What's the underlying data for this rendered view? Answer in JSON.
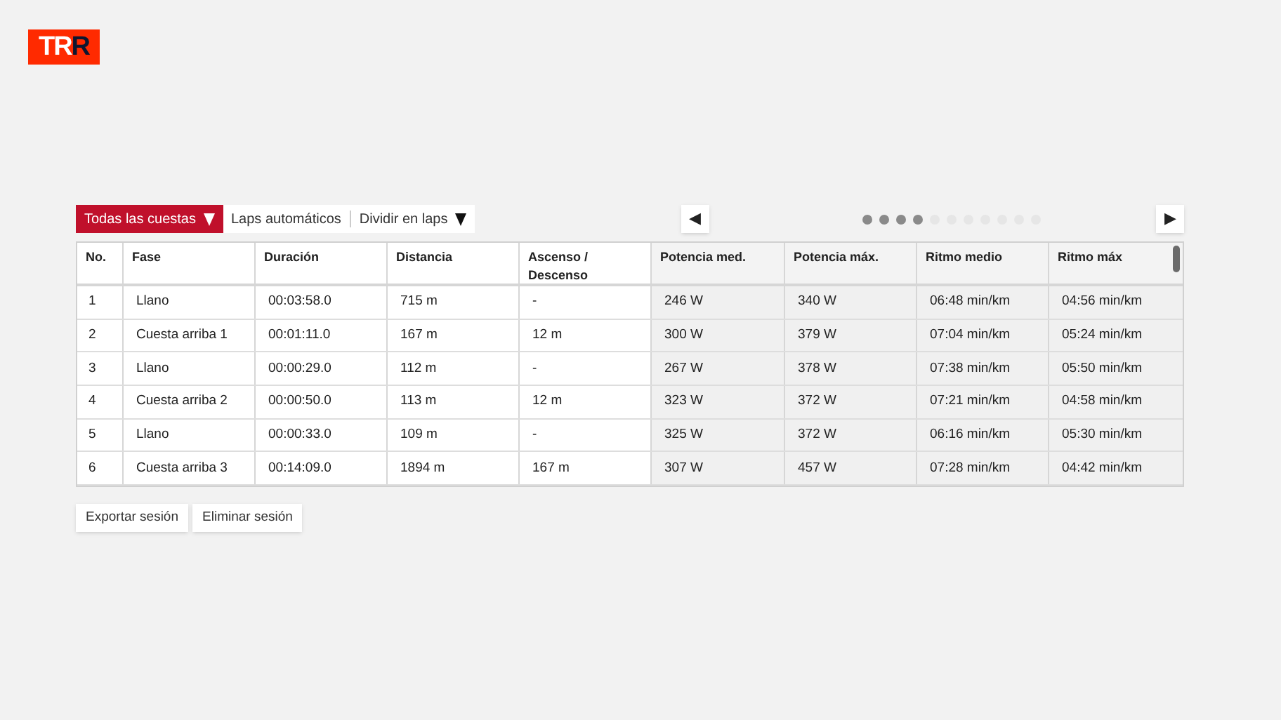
{
  "logo": {
    "parts": [
      {
        "text": "TR",
        "kind": "light"
      },
      {
        "text": "R",
        "kind": "dark"
      }
    ]
  },
  "filters": [
    {
      "label": "Todas las cuestas",
      "selected": true,
      "has_menu": true
    },
    {
      "label": "Laps automáticos",
      "selected": false,
      "has_menu": false
    },
    {
      "label": "Dividir en laps",
      "selected": false,
      "has_menu": true
    }
  ],
  "pager": {
    "prev": "◀",
    "next": "▶",
    "dots": [
      {
        "filled": true
      },
      {
        "filled": true
      },
      {
        "filled": true
      },
      {
        "filled": true
      },
      {
        "filled": false
      },
      {
        "filled": false
      },
      {
        "filled": false
      },
      {
        "filled": false
      },
      {
        "filled": false
      },
      {
        "filled": false
      },
      {
        "filled": false
      }
    ]
  },
  "table": {
    "columns": [
      {
        "label": "No.",
        "shaded": false
      },
      {
        "label": "Fase",
        "shaded": false
      },
      {
        "label": "Duración",
        "shaded": false
      },
      {
        "label": "Distancia",
        "shaded": false
      },
      {
        "label": "Ascenso / Descenso",
        "shaded": false
      },
      {
        "label": "Potencia med.",
        "shaded": true
      },
      {
        "label": "Potencia máx.",
        "shaded": true
      },
      {
        "label": "Ritmo medio",
        "shaded": true
      },
      {
        "label": "Ritmo máx",
        "shaded": true
      }
    ],
    "rows": [
      [
        "1",
        "Llano",
        "00:03:58.0",
        "715 m",
        "-",
        "246 W",
        "340 W",
        "06:48 min/km",
        "04:56 min/km"
      ],
      [
        "2",
        "Cuesta arriba 1",
        "00:01:11.0",
        "167 m",
        "12 m",
        "300 W",
        "379 W",
        "07:04 min/km",
        "05:24 min/km"
      ],
      [
        "3",
        "Llano",
        "00:00:29.0",
        "112 m",
        "-",
        "267 W",
        "378 W",
        "07:38 min/km",
        "05:50 min/km"
      ],
      [
        "4",
        "Cuesta arriba 2",
        "00:00:50.0",
        "113 m",
        "12 m",
        "323 W",
        "372 W",
        "07:21 min/km",
        "04:58 min/km"
      ],
      [
        "5",
        "Llano",
        "00:00:33.0",
        "109 m",
        "-",
        "325 W",
        "372 W",
        "06:16 min/km",
        "05:30 min/km"
      ],
      [
        "6",
        "Cuesta arriba 3",
        "00:14:09.0",
        "1894 m",
        "167 m",
        "307 W",
        "457 W",
        "07:28 min/km",
        "04:42 min/km"
      ]
    ]
  },
  "actions": [
    "Exportar sesión",
    "Eliminar sesión"
  ]
}
